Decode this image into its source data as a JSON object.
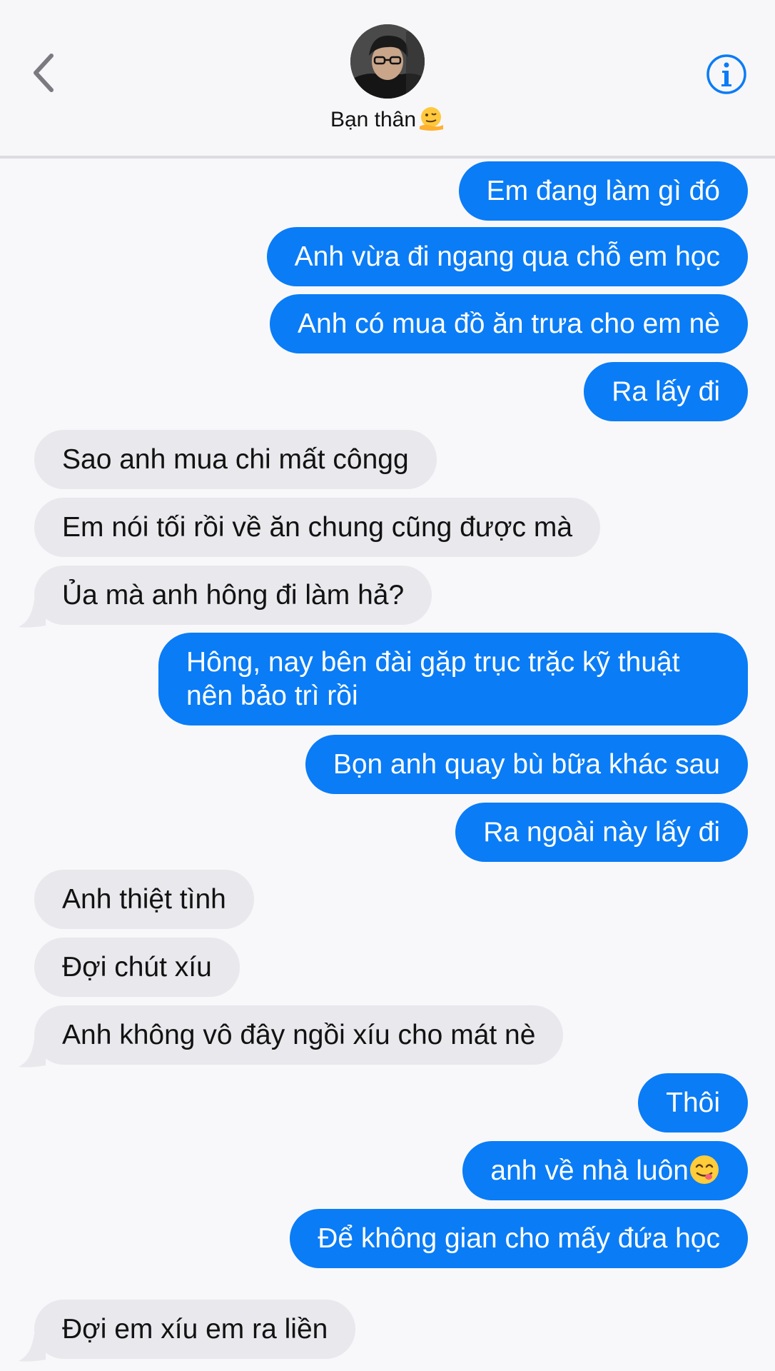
{
  "header": {
    "contact_name": "Bạn thân",
    "name_emoji_icon": "melting-face-icon",
    "back_icon": "chevron-left-icon",
    "info_icon": "info-circle-icon",
    "accent_color": "#0a7cf6"
  },
  "messages": [
    {
      "side": "out",
      "text": "Em đang làm gì đó"
    },
    {
      "side": "out",
      "text": "Anh vừa đi ngang qua chỗ em học"
    },
    {
      "side": "out",
      "text": "Anh có mua đồ ăn trưa cho em nè"
    },
    {
      "side": "out",
      "text": "Ra lấy đi"
    },
    {
      "side": "in",
      "text": "Sao anh mua chi mất côngg"
    },
    {
      "side": "in",
      "text": "Em nói tối rồi về ăn chung cũng được mà"
    },
    {
      "side": "in",
      "text": "Ủa mà anh hông đi làm hả?"
    },
    {
      "side": "out",
      "text": "Hông, nay bên đài gặp trục trặc kỹ thuật nên bảo trì rồi"
    },
    {
      "side": "out",
      "text": "Bọn anh quay bù bữa khác sau"
    },
    {
      "side": "out",
      "text": "Ra ngoài này lấy đi"
    },
    {
      "side": "in",
      "text": "Anh thiệt tình"
    },
    {
      "side": "in",
      "text": "Đợi chút xíu"
    },
    {
      "side": "in",
      "text": "Anh không vô đây ngồi xíu cho mát nè"
    },
    {
      "side": "out",
      "text": "Thôi"
    },
    {
      "side": "out",
      "text": "anh về nhà luôn",
      "emoji": "yum-face-icon"
    },
    {
      "side": "out",
      "text": "Để không gian cho mấy đứa học"
    },
    {
      "side": "in",
      "text": "Đợi em xíu em ra liền"
    }
  ],
  "colors": {
    "outgoing_bubble": "#0a7cf6",
    "incoming_bubble": "#e8e8ed"
  }
}
